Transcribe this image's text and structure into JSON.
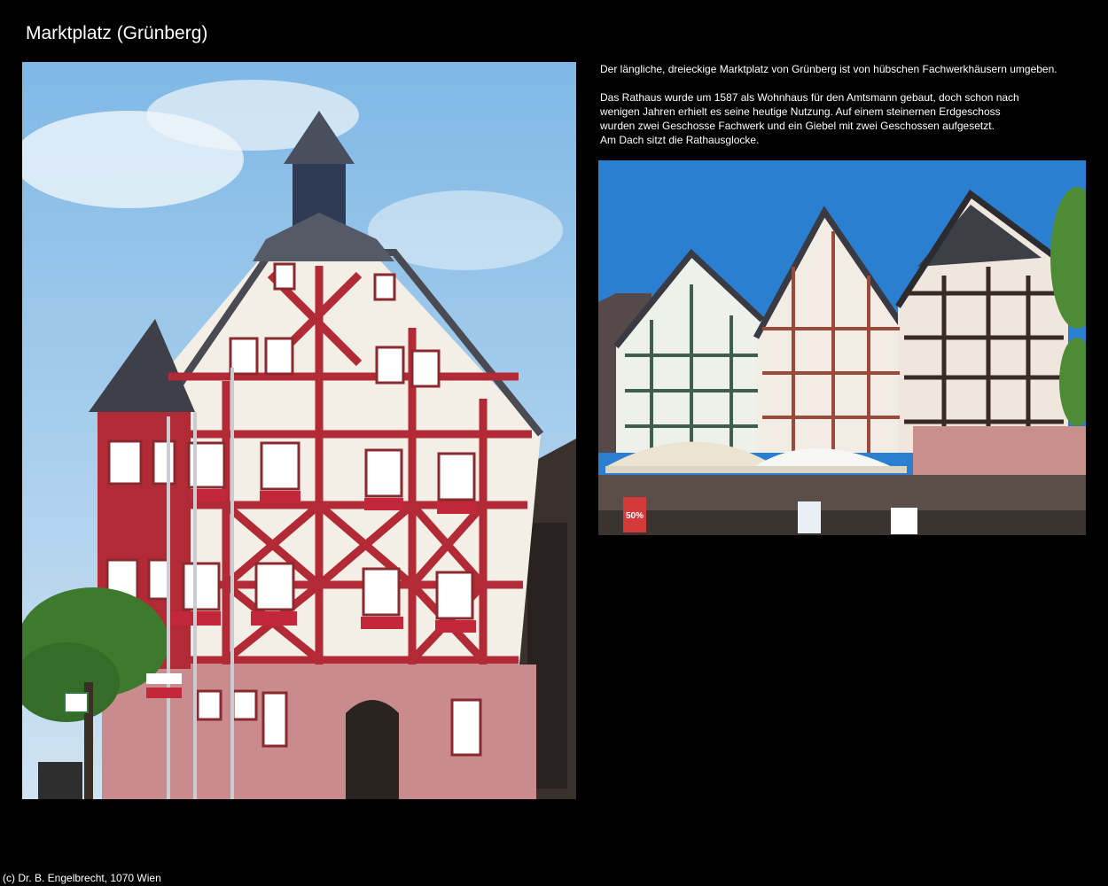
{
  "page": {
    "title": "Marktplatz (Grünberg)",
    "footer": "(c) Dr. B. Engelbrecht, 1070 Wien"
  },
  "description": {
    "paragraph1": "Der längliche, dreieckige Marktplatz von Grünberg ist von hübschen Fachwerkhäusern umgeben.",
    "paragraph2_lines": [
      "Das Rathaus wurde um 1587 als Wohnhaus für den Amtsmann gebaut, doch schon nach",
      "wenigen Jahren erhielt es seine heutige Nutzung. Auf einem steinernen Erdgeschoss",
      "wurden zwei Geschosse Fachwerk und ein Giebel mit zwei Geschossen aufgesetzt.",
      "Am Dach sitzt die Rathausglocke."
    ]
  },
  "photos": {
    "left_sign": "50%",
    "colors": {
      "sky": "#8fc3ea",
      "timber_red": "#b22a35",
      "plaster": "#f3efe6",
      "ground_floor": "#c98b8e",
      "tree": "#3e7a2e",
      "green_timber": "#3f5e4f",
      "dark_timber": "#3a2a26"
    }
  }
}
